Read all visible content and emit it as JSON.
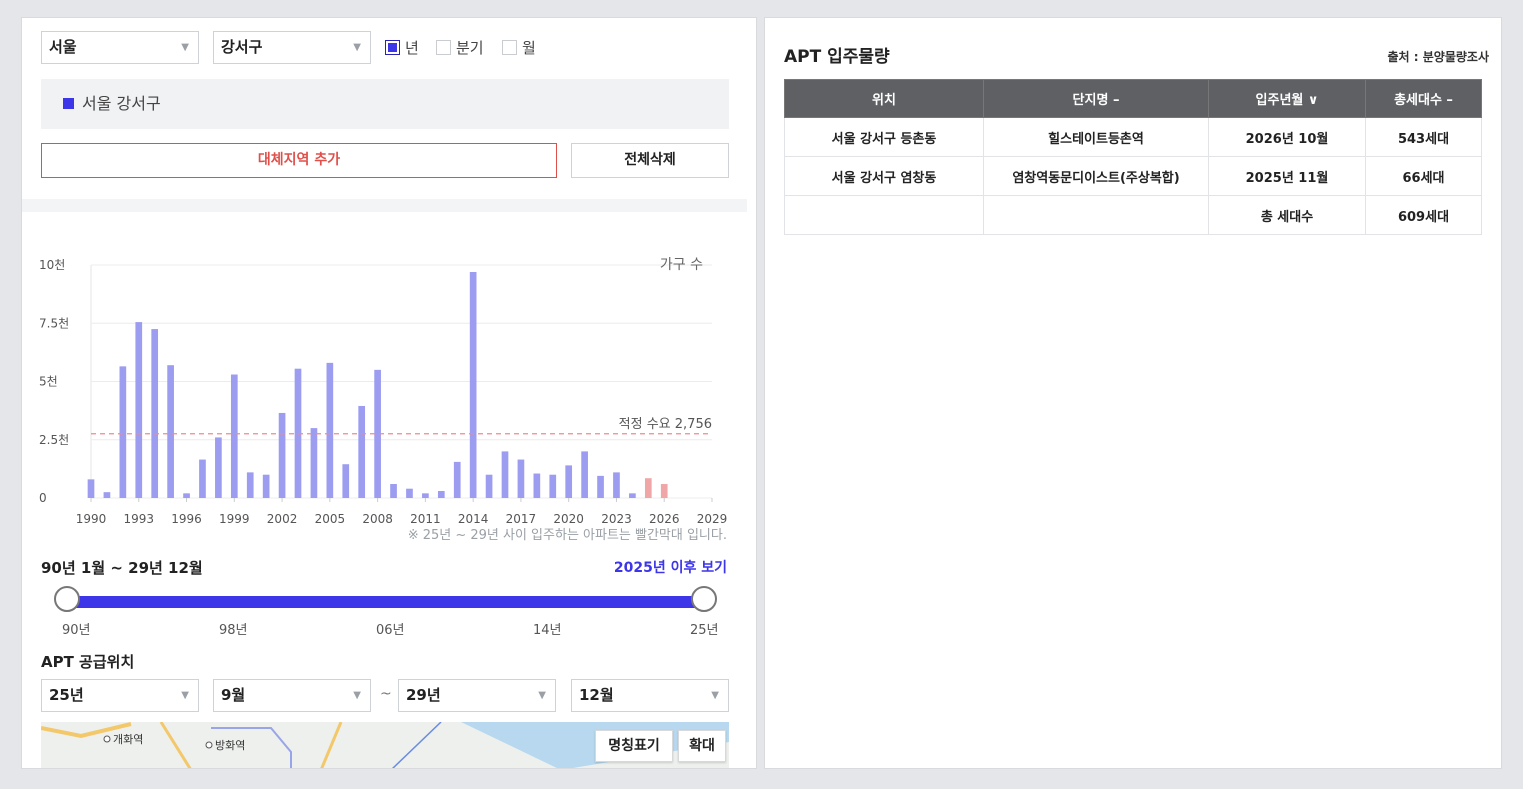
{
  "filters": {
    "city": "서울",
    "district": "강서구",
    "period_options": [
      {
        "label": "년",
        "checked": true
      },
      {
        "label": "분기",
        "checked": false
      },
      {
        "label": "월",
        "checked": false
      }
    ]
  },
  "region_item": "서울 강서구",
  "buttons": {
    "add_region": "대체지역 추가",
    "delete_all": "전체삭제"
  },
  "chart_data": {
    "type": "bar",
    "legend": "가구 수",
    "y_ticks": [
      "0",
      "2.5천",
      "5천",
      "7.5천",
      "10천"
    ],
    "ylim": [
      0,
      10000
    ],
    "x_ticks": [
      "1990",
      "1993",
      "1996",
      "1999",
      "2002",
      "2005",
      "2008",
      "2011",
      "2014",
      "2017",
      "2020",
      "2023",
      "2026",
      "2029"
    ],
    "xlim": [
      1990,
      2029
    ],
    "series": [
      {
        "color": "#9c9df0",
        "x": [
          1990,
          1991,
          1992,
          1993,
          1994,
          1995,
          1996,
          1997,
          1998,
          1999,
          2000,
          2001,
          2002,
          2003,
          2004,
          2005,
          2006,
          2007,
          2008,
          2009,
          2010,
          2011,
          2012,
          2013,
          2014,
          2015,
          2016,
          2017,
          2018,
          2019,
          2020,
          2021,
          2022,
          2023,
          2024
        ],
        "values": [
          800,
          250,
          5650,
          7550,
          7250,
          5700,
          200,
          1650,
          2600,
          5300,
          1100,
          1000,
          3650,
          5550,
          3000,
          5800,
          1450,
          3950,
          5500,
          600,
          400,
          200,
          300,
          1550,
          9700,
          1000,
          2000,
          1650,
          1050,
          1000,
          1400,
          2000,
          950,
          1100,
          200
        ]
      },
      {
        "color": "#f0a6a6",
        "x": [
          2025,
          2026
        ],
        "values": [
          850,
          600
        ]
      }
    ],
    "reference_line": {
      "label": "적정 수요 2,756",
      "value": 2756,
      "color": "#f08a8a"
    }
  },
  "chart_note": "※ 25년 ~ 29년 사이 입주하는 아파트는 빨간막대 입니다.",
  "range": {
    "label": "90년 1월 ~ 29년 12월",
    "after_link": "2025년 이후 보기",
    "ticks": [
      "90년",
      "98년",
      "06년",
      "14년",
      "25년"
    ]
  },
  "supply": {
    "title": "APT 공급위치",
    "from_year": "25년",
    "from_month": "9월",
    "tilde": "~",
    "to_year": "29년",
    "to_month": "12월",
    "map_labels": [
      "개화역",
      "방화역"
    ],
    "map_buttons": [
      "명칭표기",
      "확대"
    ]
  },
  "right": {
    "title": "APT 입주물량",
    "source": "출처 : 분양물량조사",
    "columns": [
      "위치",
      "단지명 –",
      "입주년월 ∨",
      "총세대수 –"
    ],
    "rows": [
      [
        "서울 강서구 등촌동",
        "힐스테이트등촌역",
        "2026년 10월",
        "543세대"
      ],
      [
        "서울 강서구 염창동",
        "염창역동문디이스트(주상복합)",
        "2025년 11월",
        "66세대"
      ],
      [
        "",
        "",
        "총 세대수",
        "609세대"
      ]
    ]
  }
}
